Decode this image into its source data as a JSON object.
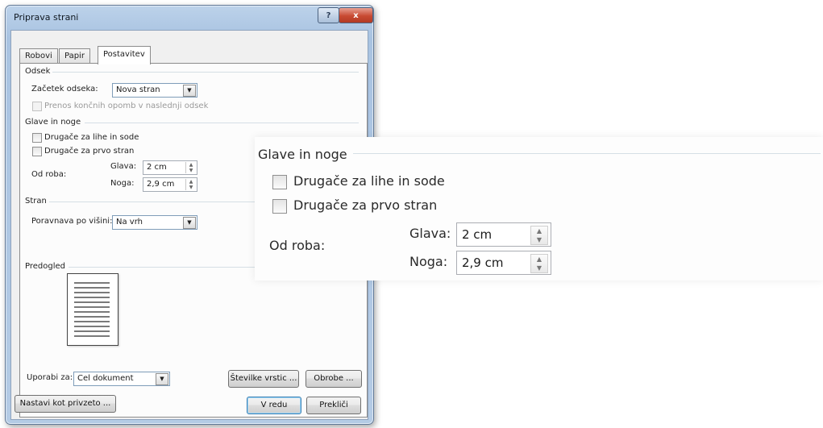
{
  "dialog": {
    "title": "Priprava strani",
    "help_button": "?",
    "close_button": "x",
    "tabs": [
      {
        "label": "Robovi"
      },
      {
        "label": "Papir"
      },
      {
        "label": "Postavitev",
        "active": true
      }
    ]
  },
  "odsek": {
    "group_label": "Odsek",
    "section_start_label": "Začetek odseka:",
    "section_start_value": "Nova stran",
    "suppress_endnotes_label": "Prenos končnih opomb v naslednji odsek"
  },
  "headers": {
    "group_label": "Glave in noge",
    "odd_even_label": "Drugače za lihe in sode",
    "first_page_label": "Drugače za prvo stran",
    "from_edge_label": "Od roba:",
    "header_label": "Glava:",
    "header_value": "2 cm",
    "footer_label": "Noga:",
    "footer_value": "2,9 cm"
  },
  "stran": {
    "group_label": "Stran",
    "vertical_align_label": "Poravnava po višini:",
    "vertical_align_value": "Na vrh"
  },
  "preview": {
    "group_label": "Predogled"
  },
  "bottom": {
    "apply_to_label": "Uporabi za:",
    "apply_to_value": "Cel dokument",
    "line_numbers_button": "Številke vrstic ...",
    "borders_button": "Obrobe ...",
    "set_default_button": "Nastavi kot privzeto ...",
    "ok_button": "V redu",
    "cancel_button": "Prekliči"
  },
  "zoom": {
    "group_label": "Glave in noge",
    "odd_even_label": "Drugače za lihe in sode",
    "first_page_label": "Drugače za prvo stran",
    "from_edge_label": "Od roba:",
    "header_label": "Glava:",
    "header_value": "2 cm",
    "footer_label": "Noga:",
    "footer_value": "2,9 cm"
  },
  "colors": {
    "title_bar": "#bcd2ea",
    "close_button": "#c84a32",
    "dialog_background": "#f0f0f0"
  }
}
